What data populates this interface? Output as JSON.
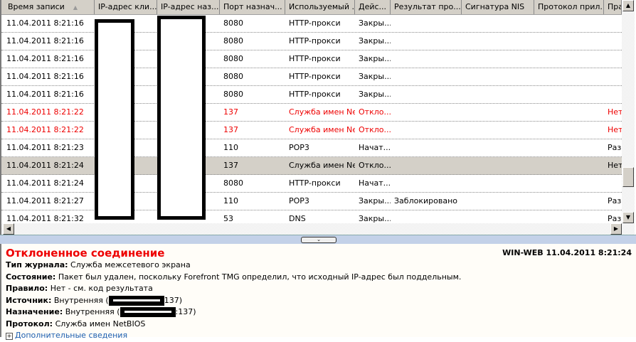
{
  "columns": [
    "Время записи",
    "IP-адрес кли...",
    "IP-адрес наз...",
    "Порт назнач...",
    "Используемый ...",
    "Дейс...",
    "Результат про...",
    "Сигнатура NIS",
    "Протокол прил...",
    "Пра"
  ],
  "rows": [
    {
      "time": "11.04.2011 8:21:16",
      "port": "8080",
      "proto": "HTTP-прокси",
      "action": "Закры...",
      "result": "",
      "rule": "",
      "style": "normal"
    },
    {
      "time": "11.04.2011 8:21:16",
      "port": "8080",
      "proto": "HTTP-прокси",
      "action": "Закры...",
      "result": "",
      "rule": "",
      "style": "normal"
    },
    {
      "time": "11.04.2011 8:21:16",
      "port": "8080",
      "proto": "HTTP-прокси",
      "action": "Закры...",
      "result": "",
      "rule": "",
      "style": "normal"
    },
    {
      "time": "11.04.2011 8:21:16",
      "port": "8080",
      "proto": "HTTP-прокси",
      "action": "Закры...",
      "result": "",
      "rule": "",
      "style": "normal"
    },
    {
      "time": "11.04.2011 8:21:16",
      "port": "8080",
      "proto": "HTTP-прокси",
      "action": "Закры...",
      "result": "",
      "rule": "",
      "style": "normal"
    },
    {
      "time": "11.04.2011 8:21:22",
      "port": "137",
      "proto": "Служба имен Ne...",
      "action": "Откло...",
      "result": "",
      "rule": "Нет",
      "style": "red"
    },
    {
      "time": "11.04.2011 8:21:22",
      "port": "137",
      "proto": "Служба имен Ne...",
      "action": "Откло...",
      "result": "",
      "rule": "Нет",
      "style": "red"
    },
    {
      "time": "11.04.2011 8:21:23",
      "port": "110",
      "proto": "POP3",
      "action": "Начат...",
      "result": "",
      "rule": "Разр",
      "style": "normal"
    },
    {
      "time": "11.04.2011 8:21:24",
      "port": "137",
      "proto": "Служба имен Ne...",
      "action": "Откло...",
      "result": "",
      "rule": "Нет",
      "style": "selected"
    },
    {
      "time": "11.04.2011 8:21:24",
      "port": "8080",
      "proto": "HTTP-прокси",
      "action": "Начат...",
      "result": "",
      "rule": "",
      "style": "normal"
    },
    {
      "time": "11.04.2011 8:21:27",
      "port": "110",
      "proto": "POP3",
      "action": "Закры...",
      "result": "Заблокировано",
      "rule": "Разр",
      "style": "normal"
    },
    {
      "time": "11.04.2011 8:21:32",
      "port": "53",
      "proto": "DNS",
      "action": "Закры...",
      "result": "",
      "rule": "Разр",
      "style": "normal"
    }
  ],
  "details": {
    "title": "Отклоненное соединение",
    "stamp": "WIN-WEB 11.04.2011 8:21:24",
    "fields": [
      {
        "label": "Тип журнала:",
        "value": "Служба межсетевого экрана"
      },
      {
        "label": "Состояние:",
        "value": "Пакет был удален, поскольку Forefront TMG определил, что исходный IP-адрес был поддельным."
      },
      {
        "label": "Правило:",
        "value": "Нет - см. код результата"
      }
    ],
    "source_label": "Источник:",
    "source_prefix": "Внутренняя (",
    "source_suffix": "137)",
    "dest_label": "Назначение:",
    "dest_prefix": "Внутренняя (",
    "dest_suffix": ":137)",
    "protocol_label": "Протокол:",
    "protocol_value": "Служба имен NetBIOS",
    "more": "Дополнительные сведения"
  }
}
